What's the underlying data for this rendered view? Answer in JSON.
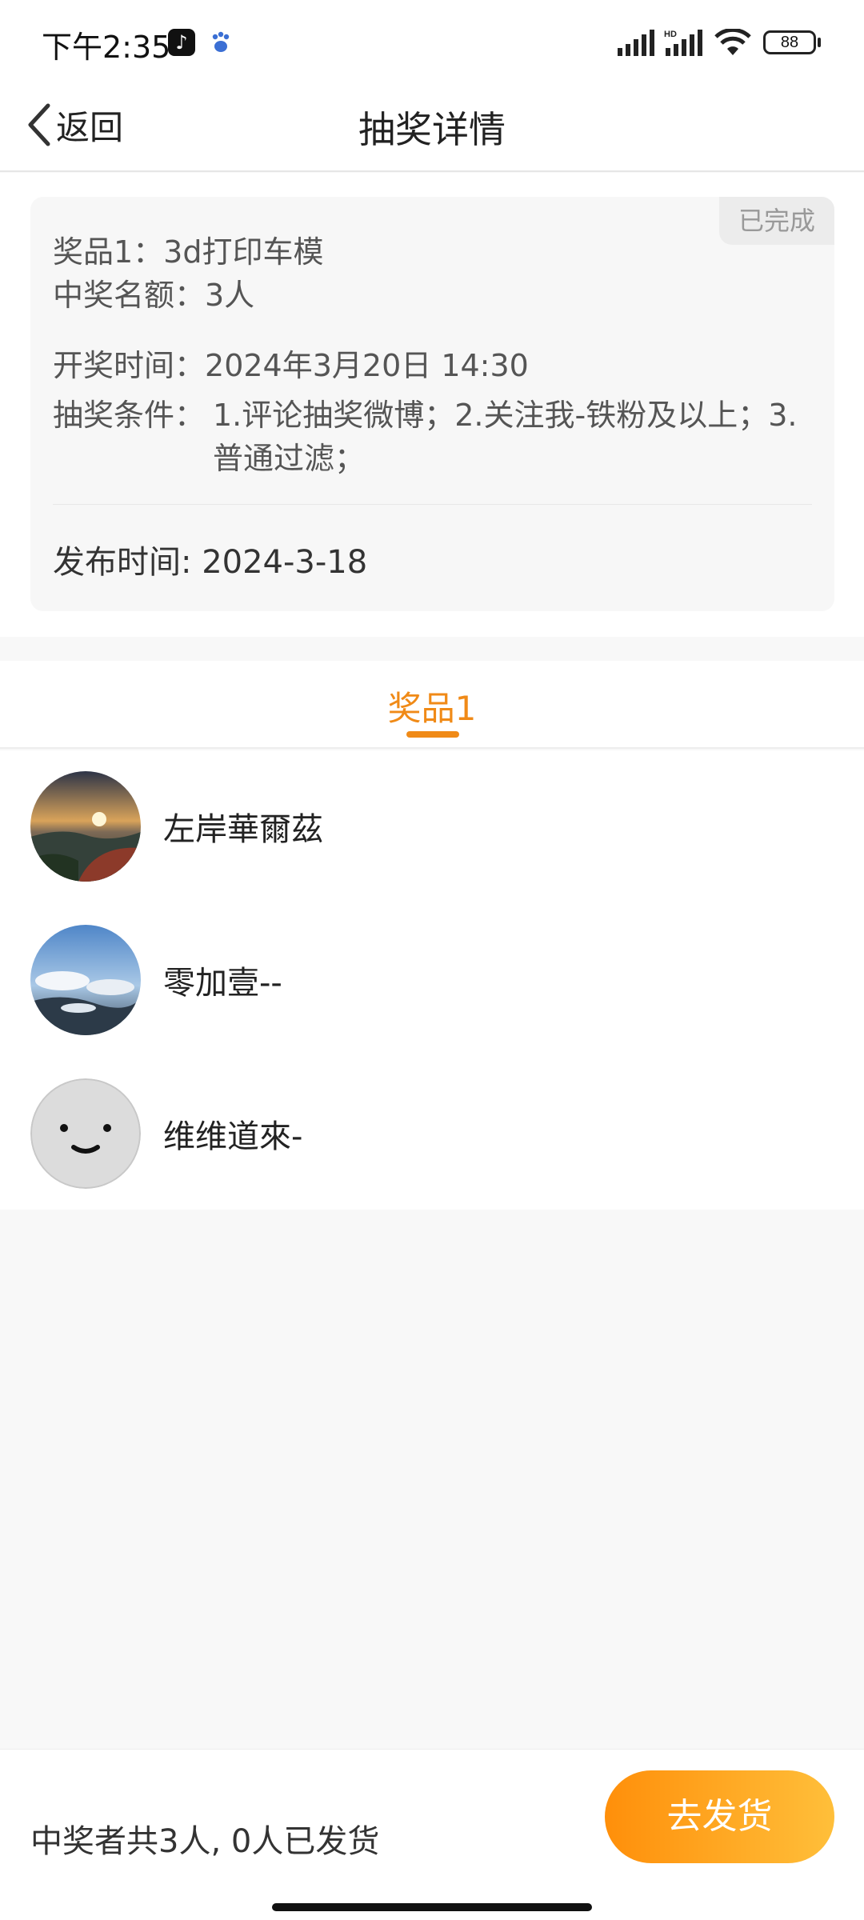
{
  "status_bar": {
    "time": "下午2:35",
    "battery": "88",
    "icons": [
      "tiktok-icon",
      "baidu-paw-icon",
      "signal-icon",
      "hd-signal-icon",
      "wifi-icon",
      "battery-icon"
    ]
  },
  "nav": {
    "back_label": "返回",
    "title": "抽奖详情"
  },
  "detail": {
    "status": "已完成",
    "prize": "奖品1：3d打印车模",
    "quota": "中奖名额：3人",
    "draw_time_label": "开奖时间：",
    "draw_time_value": "2024年3月20日 14:30",
    "condition_label": "抽奖条件：",
    "condition_value": "1.评论抽奖微博；2.关注我-铁粉及以上；3.普通过滤；",
    "publish": "发布时间: 2024-3-18"
  },
  "tabs": [
    {
      "label": "奖品1",
      "active": true
    }
  ],
  "winners": [
    {
      "name": "左岸華爾茲",
      "avatar": "sunset-landscape-avatar"
    },
    {
      "name": "零加壹--",
      "avatar": "sky-clouds-avatar"
    },
    {
      "name": "维维道來-",
      "avatar": "default-smiley-avatar"
    }
  ],
  "footer": {
    "summary": "中奖者共3人, 0人已发货",
    "ship_button": "去发货"
  },
  "colors": {
    "accent": "#f08a17",
    "button_gradient_start": "#ff8f0a",
    "button_gradient_end": "#ffbf3a"
  }
}
